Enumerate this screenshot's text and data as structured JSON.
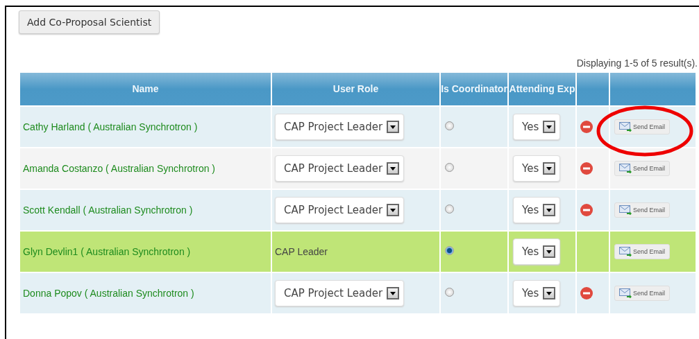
{
  "add_button": "Add Co-Proposal Scientist",
  "result_count": "Displaying 1-5 of 5 result(s).",
  "table": {
    "columns": [
      "Name",
      "User Role",
      "Is Coordinator",
      "Attending Exp"
    ],
    "rows": [
      {
        "name": "Cathy Harland ( Australian Synchrotron )",
        "role": {
          "kind": "select",
          "value": "CAP Project Leader"
        },
        "coordinator": false,
        "attending": "Yes",
        "removable": true,
        "highlighted": false,
        "email": "Send Email"
      },
      {
        "name": "Amanda Costanzo ( Australian Synchrotron )",
        "role": {
          "kind": "select",
          "value": "CAP Project Leader"
        },
        "coordinator": false,
        "attending": "Yes",
        "removable": true,
        "highlighted": false,
        "email": "Send Email"
      },
      {
        "name": "Scott Kendall ( Australian Synchrotron )",
        "role": {
          "kind": "select",
          "value": "CAP Project Leader"
        },
        "coordinator": false,
        "attending": "Yes",
        "removable": true,
        "highlighted": false,
        "email": "Send Email"
      },
      {
        "name": "Glyn Devlin1 ( Australian Synchrotron )",
        "role": {
          "kind": "text",
          "value": "CAP Leader"
        },
        "coordinator": true,
        "attending": "Yes",
        "removable": false,
        "highlighted": true,
        "email": "Send Email"
      },
      {
        "name": "Donna Popov ( Australian Synchrotron )",
        "role": {
          "kind": "select",
          "value": "CAP Project Leader"
        },
        "coordinator": false,
        "attending": "Yes",
        "removable": true,
        "highlighted": false,
        "email": "Send Email"
      }
    ]
  }
}
